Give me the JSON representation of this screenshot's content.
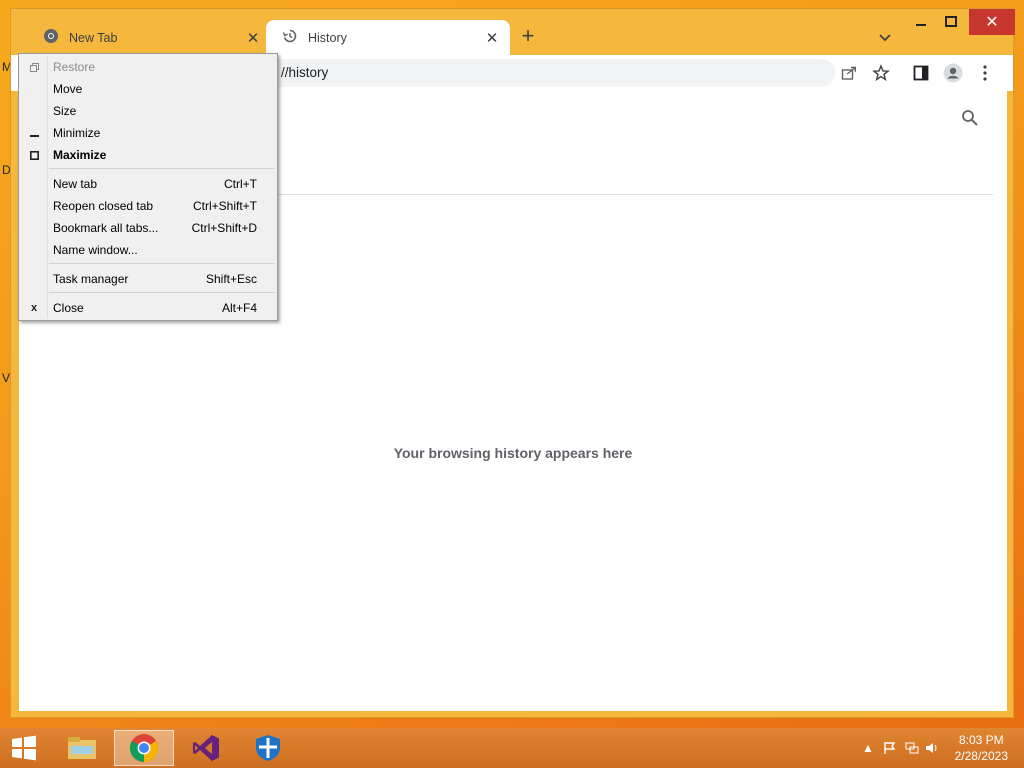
{
  "desktop": {
    "peek_letters": [
      "M",
      "D",
      "V"
    ]
  },
  "tabs": [
    {
      "title": "New Tab",
      "icon": "chrome-icon",
      "active": false
    },
    {
      "title": "History",
      "icon": "history-icon",
      "active": true
    }
  ],
  "window_controls": {
    "minimize": "minimize-icon",
    "maximize": "maximize-icon",
    "close": "close-icon"
  },
  "omnibox": {
    "url_visible": "//history"
  },
  "content": {
    "empty_message": "Your browsing history appears here"
  },
  "system_menu": {
    "items": [
      {
        "label": "Restore",
        "glyph": "restore-icon",
        "disabled": true
      },
      {
        "label": "Move"
      },
      {
        "label": "Size"
      },
      {
        "label": "Minimize",
        "glyph": "minimize-icon"
      },
      {
        "label": "Maximize",
        "glyph": "maximize-icon",
        "bold": true
      },
      {
        "label": "New tab",
        "shortcut": "Ctrl+T"
      },
      {
        "label": "Reopen closed tab",
        "shortcut": "Ctrl+Shift+T"
      },
      {
        "label": "Bookmark all tabs...",
        "shortcut": "Ctrl+Shift+D"
      },
      {
        "label": "Name window..."
      },
      {
        "label": "Task manager",
        "shortcut": "Shift+Esc"
      },
      {
        "label": "Close",
        "shortcut": "Alt+F4",
        "glyph": "close-icon"
      }
    ]
  },
  "taskbar": {
    "apps": [
      "start-icon",
      "file-explorer-icon",
      "chrome-icon",
      "visual-studio-icon",
      "defender-icon"
    ],
    "clock": {
      "time": "8:03 PM",
      "date": "2/28/2023"
    }
  },
  "colors": {
    "accent": "#f5b83d",
    "taskbar": "#d67a2a",
    "close_red": "#c7372f"
  }
}
